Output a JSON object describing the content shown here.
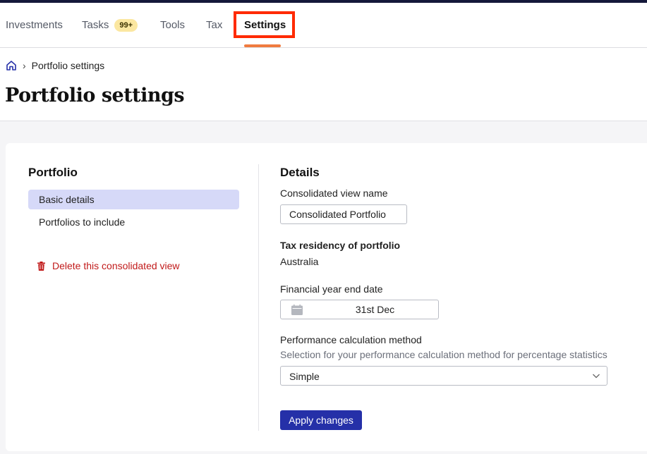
{
  "nav": {
    "items": [
      {
        "label": "Investments"
      },
      {
        "label": "Tasks",
        "badge": "99+"
      },
      {
        "label": "Tools"
      },
      {
        "label": "Tax"
      },
      {
        "label": "Settings",
        "active": true
      }
    ]
  },
  "breadcrumb": {
    "home_icon": "home-icon",
    "current": "Portfolio settings"
  },
  "page": {
    "title": "Portfolio settings"
  },
  "sidebar": {
    "title": "Portfolio",
    "items": [
      {
        "label": "Basic details",
        "selected": true
      },
      {
        "label": "Portfolios to include"
      }
    ],
    "delete_label": "Delete this consolidated view",
    "delete_icon": "trash-icon"
  },
  "details": {
    "title": "Details",
    "view_name_label": "Consolidated view name",
    "view_name_value": "Consolidated Portfolio",
    "tax_residency_label": "Tax residency of portfolio",
    "tax_residency_value": "Australia",
    "fy_end_label": "Financial year end date",
    "fy_end_value": "31st Dec",
    "perf_label": "Performance calculation method",
    "perf_help": "Selection for your performance calculation method for percentage statistics",
    "perf_value": "Simple",
    "apply_label": "Apply changes"
  },
  "colors": {
    "accent": "#2530a8",
    "tab_underline": "#f07b3f",
    "highlight": "#ff2a00",
    "danger": "#c11a1a",
    "selected_bg": "#d6d9f8",
    "badge_bg": "#fbe7a1"
  }
}
